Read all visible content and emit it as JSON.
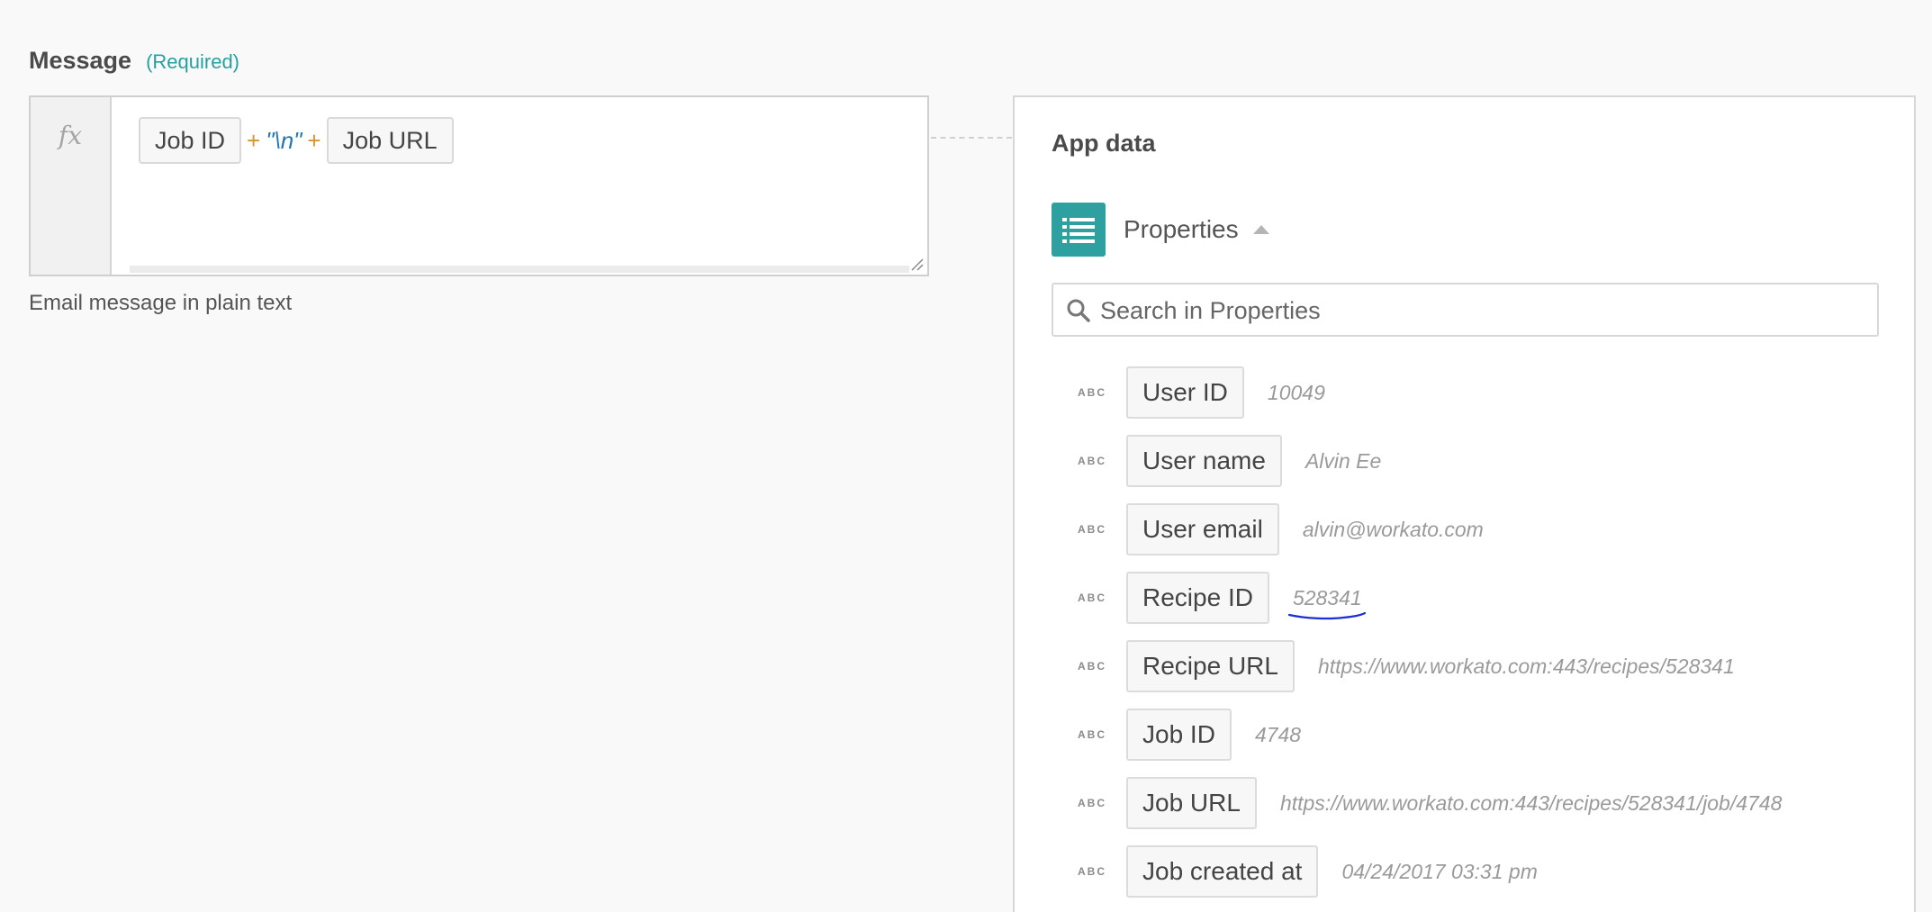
{
  "message": {
    "label": "Message",
    "required": "(Required)",
    "hint": "Email message in plain text",
    "formula_icon": "fx",
    "formula": {
      "pill1": "Job ID",
      "plus1": "+",
      "string": "\"\\n\"",
      "plus2": "+",
      "pill2": "Job URL"
    }
  },
  "app_data": {
    "title": "App data",
    "section": "Properties",
    "search_placeholder": "Search in Properties",
    "type_badge": "ABC",
    "properties": [
      {
        "name": "User ID",
        "value": "10049"
      },
      {
        "name": "User name",
        "value": "Alvin Ee"
      },
      {
        "name": "User email",
        "value": "alvin@workato.com"
      },
      {
        "name": "Recipe ID",
        "value": "528341"
      },
      {
        "name": "Recipe URL",
        "value": "https://www.workato.com:443/recipes/528341"
      },
      {
        "name": "Job ID",
        "value": "4748"
      },
      {
        "name": "Job URL",
        "value": "https://www.workato.com:443/recipes/528341/job/4748"
      },
      {
        "name": "Job created at",
        "value": "04/24/2017 03:31 pm"
      }
    ]
  },
  "colors": {
    "accent": "#2fa0a0",
    "required": "#26a0a0",
    "operator": "#d49730",
    "string": "#2276b2",
    "annotation": "#1a2fd6"
  },
  "icons": [
    "fx-icon",
    "list-icon",
    "caret-up-icon",
    "search-icon",
    "resize-grip-icon"
  ]
}
